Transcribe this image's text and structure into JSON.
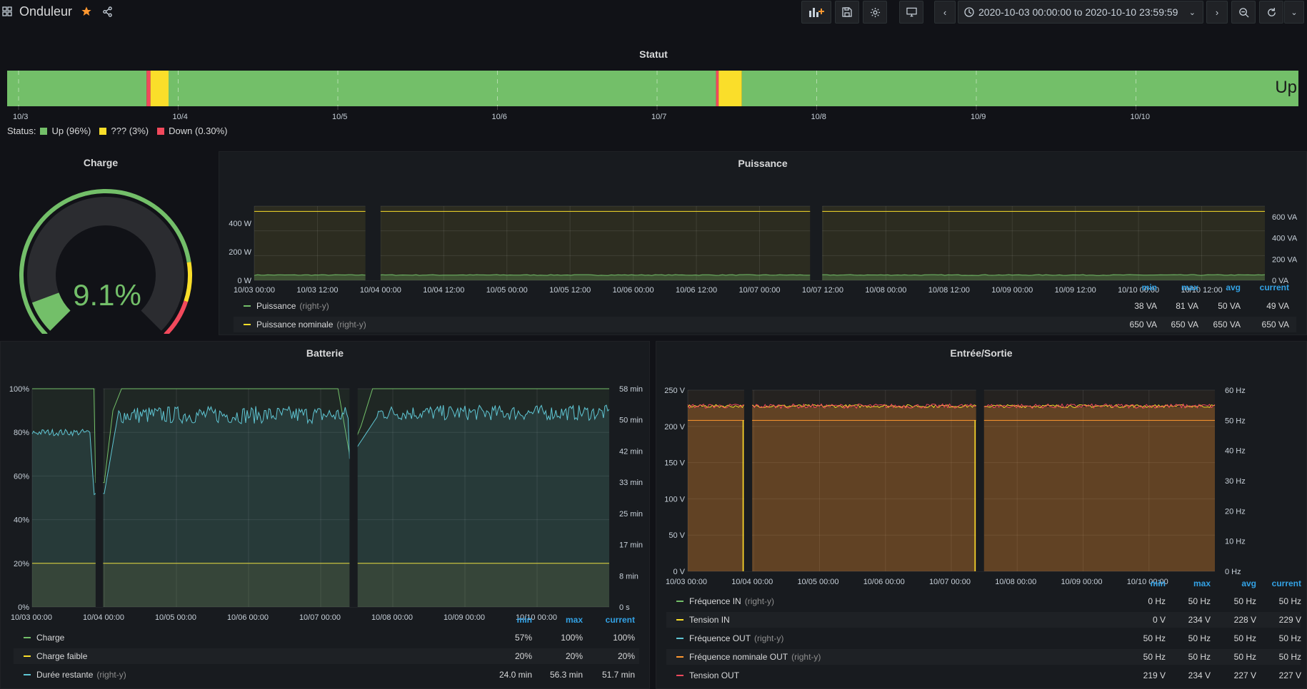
{
  "header": {
    "title": "Onduleur",
    "time_range": "2020-10-03 00:00:00 to 2020-10-10 23:59:59"
  },
  "colors": {
    "green": "#73bf69",
    "yellow": "#fade2a",
    "red": "#f2495c",
    "cyan": "#5fc6d4",
    "orange": "#ff9830",
    "blue": "#33a2e5"
  },
  "statut": {
    "title": "Statut",
    "current_label": "Up",
    "ticks": [
      "10/3",
      "10/4",
      "10/5",
      "10/6",
      "10/7",
      "10/8",
      "10/9",
      "10/10"
    ],
    "legend_prefix": "Status:",
    "legend": [
      {
        "label": "Up (96%)",
        "color": "#73bf69"
      },
      {
        "label": "??? (3%)",
        "color": "#fade2a"
      },
      {
        "label": "Down (0.30%)",
        "color": "#f2495c"
      }
    ],
    "segments": [
      {
        "state": "Up",
        "from": 0.0,
        "to": 0.108
      },
      {
        "state": "Down",
        "from": 0.108,
        "to": 0.111
      },
      {
        "state": "???",
        "from": 0.111,
        "to": 0.125
      },
      {
        "state": "Up",
        "from": 0.125,
        "to": 0.549
      },
      {
        "state": "Down",
        "from": 0.549,
        "to": 0.551
      },
      {
        "state": "???",
        "from": 0.551,
        "to": 0.569
      },
      {
        "state": "Up",
        "from": 0.569,
        "to": 1.0
      }
    ]
  },
  "charge": {
    "title": "Charge",
    "value_text": "9.1%",
    "value": 9.1,
    "thresholds": [
      {
        "from": 0,
        "to": 80,
        "color": "#73bf69"
      },
      {
        "from": 80,
        "to": 90,
        "color": "#fade2a"
      },
      {
        "from": 90,
        "to": 100,
        "color": "#f2495c"
      }
    ]
  },
  "puissance": {
    "title": "Puissance",
    "x_ticks": [
      "10/03 00:00",
      "10/03 12:00",
      "10/04 00:00",
      "10/04 12:00",
      "10/05 00:00",
      "10/05 12:00",
      "10/06 00:00",
      "10/06 12:00",
      "10/07 00:00",
      "10/07 12:00",
      "10/08 00:00",
      "10/08 12:00",
      "10/09 00:00",
      "10/09 12:00",
      "10/10 00:00",
      "10/10 12:00"
    ],
    "y_left_ticks": [
      "0 W",
      "200 W",
      "400 W"
    ],
    "y_right_ticks": [
      "0 VA",
      "200 VA",
      "400 VA",
      "600 VA"
    ],
    "legend_headers": [
      "min",
      "max",
      "avg",
      "current"
    ],
    "legend": [
      {
        "name": "Puissance",
        "sub": "(right-y)",
        "color": "#73bf69",
        "values": [
          "38 VA",
          "81 VA",
          "50 VA",
          "49 VA"
        ]
      },
      {
        "name": "Puissance nominale",
        "sub": "(right-y)",
        "color": "#fade2a",
        "values": [
          "650 VA",
          "650 VA",
          "650 VA",
          "650 VA"
        ]
      }
    ]
  },
  "batterie": {
    "title": "Batterie",
    "x_ticks": [
      "10/03 00:00",
      "10/04 00:00",
      "10/05 00:00",
      "10/06 00:00",
      "10/07 00:00",
      "10/08 00:00",
      "10/09 00:00",
      "10/10 00:00"
    ],
    "y_left_ticks": [
      "0%",
      "20%",
      "40%",
      "60%",
      "80%",
      "100%"
    ],
    "y_right_ticks": [
      "0 s",
      "8 min",
      "17 min",
      "25 min",
      "33 min",
      "42 min",
      "50 min",
      "58 min"
    ],
    "legend_headers": [
      "min",
      "max",
      "current"
    ],
    "legend": [
      {
        "name": "Charge",
        "sub": "",
        "color": "#73bf69",
        "values": [
          "57%",
          "100%",
          "100%"
        ]
      },
      {
        "name": "Charge faible",
        "sub": "",
        "color": "#fade2a",
        "values": [
          "20%",
          "20%",
          "20%"
        ]
      },
      {
        "name": "Durée restante",
        "sub": "(right-y)",
        "color": "#5fc6d4",
        "values": [
          "24.0 min",
          "56.3 min",
          "51.7 min"
        ]
      }
    ]
  },
  "io": {
    "title": "Entrée/Sortie",
    "x_ticks": [
      "10/03 00:00",
      "10/04 00:00",
      "10/05 00:00",
      "10/06 00:00",
      "10/07 00:00",
      "10/08 00:00",
      "10/09 00:00",
      "10/10 00:00"
    ],
    "y_left_ticks": [
      "0 V",
      "50 V",
      "100 V",
      "150 V",
      "200 V",
      "250 V"
    ],
    "y_right_ticks": [
      "0 Hz",
      "10 Hz",
      "20 Hz",
      "30 Hz",
      "40 Hz",
      "50 Hz",
      "60 Hz"
    ],
    "legend_headers": [
      "min",
      "max",
      "avg",
      "current"
    ],
    "legend": [
      {
        "name": "Fréquence IN",
        "sub": "(right-y)",
        "color": "#73bf69",
        "values": [
          "0 Hz",
          "50 Hz",
          "50 Hz",
          "50 Hz"
        ]
      },
      {
        "name": "Tension IN",
        "sub": "",
        "color": "#fade2a",
        "values": [
          "0 V",
          "234 V",
          "228 V",
          "229 V"
        ]
      },
      {
        "name": "Fréquence OUT",
        "sub": "(right-y)",
        "color": "#5fc6d4",
        "values": [
          "50 Hz",
          "50 Hz",
          "50 Hz",
          "50 Hz"
        ]
      },
      {
        "name": "Fréquence nominale OUT",
        "sub": "(right-y)",
        "color": "#ff9830",
        "values": [
          "50 Hz",
          "50 Hz",
          "50 Hz",
          "50 Hz"
        ]
      },
      {
        "name": "Tension OUT",
        "sub": "",
        "color": "#f2495c",
        "values": [
          "219 V",
          "234 V",
          "227 V",
          "227 V"
        ]
      }
    ]
  },
  "chart_data": [
    {
      "type": "gauge",
      "title": "Charge",
      "value": 9.1,
      "ylim": [
        0,
        100
      ]
    },
    {
      "type": "line",
      "title": "Puissance",
      "x_range": [
        "10/03 00:00",
        "10/10 23:59"
      ],
      "y_right_range": [
        0,
        700
      ],
      "series": [
        {
          "name": "Puissance",
          "values_approx": 50,
          "range": [
            38,
            81
          ]
        },
        {
          "name": "Puissance nominale",
          "values_approx": 650
        }
      ],
      "gaps": [
        [
          0.11,
          0.127
        ],
        [
          0.55,
          0.565
        ]
      ]
    },
    {
      "type": "area",
      "title": "Batterie",
      "x_range": [
        "10/03 00:00",
        "10/10 23:59"
      ],
      "ylim": [
        0,
        100
      ],
      "series": [
        {
          "name": "Charge",
          "values_approx": 100,
          "min": 57
        },
        {
          "name": "Charge faible",
          "values_approx": 20
        },
        {
          "name": "Durée restante",
          "range": [
            24.0,
            56.3
          ],
          "current": 51.7
        }
      ]
    },
    {
      "type": "area",
      "title": "Entrée/Sortie",
      "x_range": [
        "10/03 00:00",
        "10/10 23:59"
      ],
      "ylim": [
        0,
        250
      ],
      "y_right_range": [
        0,
        60
      ],
      "series": [
        {
          "name": "Fréquence IN",
          "values_approx": 50
        },
        {
          "name": "Tension IN",
          "values_approx": 228
        },
        {
          "name": "Fréquence OUT",
          "values_approx": 50
        },
        {
          "name": "Fréquence nominale OUT",
          "values_approx": 50
        },
        {
          "name": "Tension OUT",
          "values_approx": 227
        }
      ]
    }
  ]
}
